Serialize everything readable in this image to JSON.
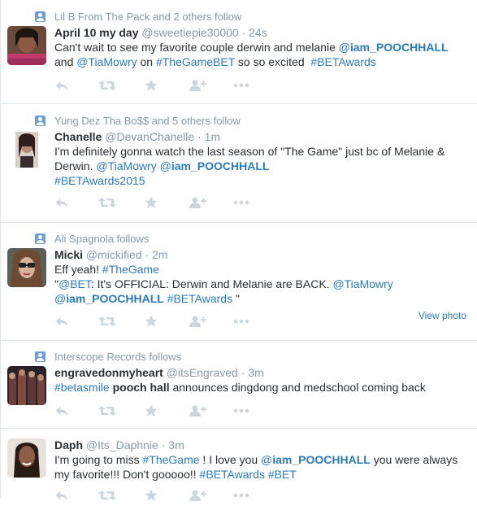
{
  "colors": {
    "link": "#2b7bb9",
    "muted": "#8899a6",
    "icon": "#ccd6dd",
    "text": "#292f33"
  },
  "tweets": [
    {
      "context": "Lil B From The Pack and 2 others follow",
      "name": "April 10 my day",
      "handle": "@sweetiepie30000",
      "dot": "·",
      "time": "24s",
      "line1": {
        "t1": "Can't wait to see my favorite couple derwin and melanie ",
        "m1": "@",
        "m1b": "iam_POOCHHALL"
      },
      "line2": {
        "t0": "and ",
        "m2": "@TiaMowry",
        "t1": " on ",
        "h1": "#TheGameBET",
        "t2": " so so excited  ",
        "h2": "#BETAwards"
      }
    },
    {
      "context": "Yung Dez Tha Bo$$ and 5 others follow",
      "name": "Chanelle",
      "handle": "@DevanChanelle",
      "dot": "·",
      "time": "1m",
      "line1": "I'm definitely gonna watch the last season of \"The Game\" just bc of Melanie &",
      "line2": {
        "t0": "Derwin. ",
        "m1": "@TiaMowry",
        "t1": " ",
        "m2": "@",
        "m2b": "iam_POOCHHALL"
      },
      "line3": {
        "h1": "#BETAwards2015"
      }
    },
    {
      "context": "Ali Spagnola follows",
      "name": "Micki",
      "handle": "@mickified",
      "dot": "·",
      "time": "2m",
      "line1": {
        "t0": "Eff yeah! ",
        "h1": "#TheGame"
      },
      "line2": {
        "q": "\"",
        "m1": "@BET",
        "t1": ": It's OFFICIAL: Derwin and Melanie are BACK. ",
        "m2": "@TiaMowry"
      },
      "line3": {
        "m1": "@",
        "m1b": "iam_POOCHHALL",
        "t0": " ",
        "h1": "#BETAwards",
        "t1": " \""
      },
      "view_photo": "View photo"
    },
    {
      "context": "Interscope Records follows",
      "name": "engravedonmyheart",
      "handle": "@itsEngraved",
      "dot": "·",
      "time": "3m",
      "line1": {
        "h1": "#betasmile",
        "t0": " ",
        "b1": "pooch hall",
        "t1": " announces dingdong and medschool coming back"
      }
    },
    {
      "name": "Daph",
      "handle": "@Its_Daphnie",
      "dot": "·",
      "time": "3m",
      "line1": {
        "t0": "I'm going to miss ",
        "h1": "#TheGame",
        "t1": " ! I love you ",
        "m1": "@",
        "m1b": "iam_POOCHHALL",
        "t2": " you were always"
      },
      "line2": {
        "t0": "my favorite!!! Don't gooooo!! ",
        "h1": "#BETAwards",
        "t1": " ",
        "h2": "#BET"
      }
    }
  ]
}
